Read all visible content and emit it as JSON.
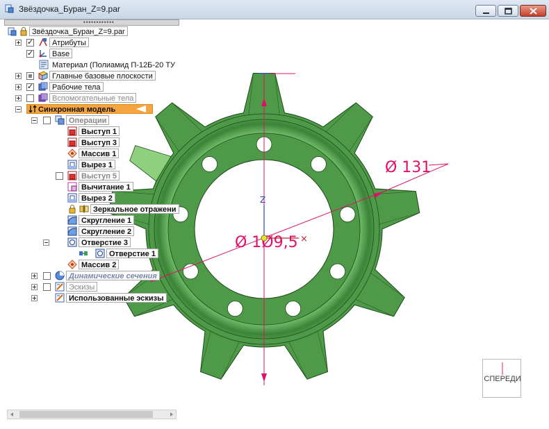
{
  "window": {
    "title": "Звёздочка_Буран_Z=9.par",
    "icon": "part-document-icon"
  },
  "tree": {
    "root": "Звёздочка_Буран_Z=9.par",
    "attributes": "Атрибуты",
    "base": "Base",
    "material": "Материал (Полиамид П-12Б-20 ТУ",
    "planes": "Главные базовые плоскости",
    "bodies": "Рабочие тела",
    "aux_bodies": "Вспомогательные тела",
    "sync_model": "Синхронная модель",
    "operations": "Операции",
    "features": [
      {
        "label": "Выступ 1"
      },
      {
        "label": "Выступ 3"
      },
      {
        "label": "Массив 1"
      },
      {
        "label": "Вырез 1"
      },
      {
        "label": "Выступ 5"
      },
      {
        "label": "Вычитание 1"
      },
      {
        "label": "Вырез 2"
      },
      {
        "label": "Зеркальное отражени"
      },
      {
        "label": "Скругление 1"
      },
      {
        "label": "Скругление 2"
      },
      {
        "label": "Отверстие 3"
      },
      {
        "label": "Отверстие 1"
      },
      {
        "label": "Массив 2"
      }
    ],
    "dyn_sections": "Динамические сечения",
    "sketches": "Эскизы",
    "used_sketches": "Использованные эскизы"
  },
  "viewport": {
    "dim_outer": "Ø 131",
    "dim_inner": "Ø 1Ø9,5",
    "axis_z": "Z",
    "view_label": "СПЕРЕДИ",
    "model_color": "#4e9a48",
    "dim_color": "#e0106a",
    "teeth_count": 9,
    "holes_count": 9
  }
}
